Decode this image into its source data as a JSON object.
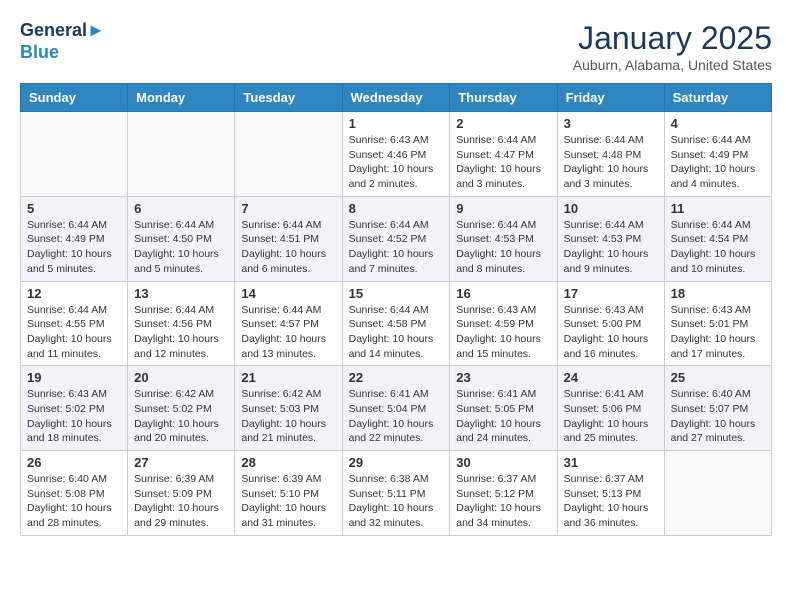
{
  "header": {
    "logo_line1": "General",
    "logo_line2": "Blue",
    "month_title": "January 2025",
    "location": "Auburn, Alabama, United States"
  },
  "days_of_week": [
    "Sunday",
    "Monday",
    "Tuesday",
    "Wednesday",
    "Thursday",
    "Friday",
    "Saturday"
  ],
  "weeks": [
    [
      {
        "day": "",
        "info": ""
      },
      {
        "day": "",
        "info": ""
      },
      {
        "day": "",
        "info": ""
      },
      {
        "day": "1",
        "info": "Sunrise: 6:43 AM\nSunset: 4:46 PM\nDaylight: 10 hours\nand 2 minutes."
      },
      {
        "day": "2",
        "info": "Sunrise: 6:44 AM\nSunset: 4:47 PM\nDaylight: 10 hours\nand 3 minutes."
      },
      {
        "day": "3",
        "info": "Sunrise: 6:44 AM\nSunset: 4:48 PM\nDaylight: 10 hours\nand 3 minutes."
      },
      {
        "day": "4",
        "info": "Sunrise: 6:44 AM\nSunset: 4:49 PM\nDaylight: 10 hours\nand 4 minutes."
      }
    ],
    [
      {
        "day": "5",
        "info": "Sunrise: 6:44 AM\nSunset: 4:49 PM\nDaylight: 10 hours\nand 5 minutes."
      },
      {
        "day": "6",
        "info": "Sunrise: 6:44 AM\nSunset: 4:50 PM\nDaylight: 10 hours\nand 5 minutes."
      },
      {
        "day": "7",
        "info": "Sunrise: 6:44 AM\nSunset: 4:51 PM\nDaylight: 10 hours\nand 6 minutes."
      },
      {
        "day": "8",
        "info": "Sunrise: 6:44 AM\nSunset: 4:52 PM\nDaylight: 10 hours\nand 7 minutes."
      },
      {
        "day": "9",
        "info": "Sunrise: 6:44 AM\nSunset: 4:53 PM\nDaylight: 10 hours\nand 8 minutes."
      },
      {
        "day": "10",
        "info": "Sunrise: 6:44 AM\nSunset: 4:53 PM\nDaylight: 10 hours\nand 9 minutes."
      },
      {
        "day": "11",
        "info": "Sunrise: 6:44 AM\nSunset: 4:54 PM\nDaylight: 10 hours\nand 10 minutes."
      }
    ],
    [
      {
        "day": "12",
        "info": "Sunrise: 6:44 AM\nSunset: 4:55 PM\nDaylight: 10 hours\nand 11 minutes."
      },
      {
        "day": "13",
        "info": "Sunrise: 6:44 AM\nSunset: 4:56 PM\nDaylight: 10 hours\nand 12 minutes."
      },
      {
        "day": "14",
        "info": "Sunrise: 6:44 AM\nSunset: 4:57 PM\nDaylight: 10 hours\nand 13 minutes."
      },
      {
        "day": "15",
        "info": "Sunrise: 6:44 AM\nSunset: 4:58 PM\nDaylight: 10 hours\nand 14 minutes."
      },
      {
        "day": "16",
        "info": "Sunrise: 6:43 AM\nSunset: 4:59 PM\nDaylight: 10 hours\nand 15 minutes."
      },
      {
        "day": "17",
        "info": "Sunrise: 6:43 AM\nSunset: 5:00 PM\nDaylight: 10 hours\nand 16 minutes."
      },
      {
        "day": "18",
        "info": "Sunrise: 6:43 AM\nSunset: 5:01 PM\nDaylight: 10 hours\nand 17 minutes."
      }
    ],
    [
      {
        "day": "19",
        "info": "Sunrise: 6:43 AM\nSunset: 5:02 PM\nDaylight: 10 hours\nand 18 minutes."
      },
      {
        "day": "20",
        "info": "Sunrise: 6:42 AM\nSunset: 5:02 PM\nDaylight: 10 hours\nand 20 minutes."
      },
      {
        "day": "21",
        "info": "Sunrise: 6:42 AM\nSunset: 5:03 PM\nDaylight: 10 hours\nand 21 minutes."
      },
      {
        "day": "22",
        "info": "Sunrise: 6:41 AM\nSunset: 5:04 PM\nDaylight: 10 hours\nand 22 minutes."
      },
      {
        "day": "23",
        "info": "Sunrise: 6:41 AM\nSunset: 5:05 PM\nDaylight: 10 hours\nand 24 minutes."
      },
      {
        "day": "24",
        "info": "Sunrise: 6:41 AM\nSunset: 5:06 PM\nDaylight: 10 hours\nand 25 minutes."
      },
      {
        "day": "25",
        "info": "Sunrise: 6:40 AM\nSunset: 5:07 PM\nDaylight: 10 hours\nand 27 minutes."
      }
    ],
    [
      {
        "day": "26",
        "info": "Sunrise: 6:40 AM\nSunset: 5:08 PM\nDaylight: 10 hours\nand 28 minutes."
      },
      {
        "day": "27",
        "info": "Sunrise: 6:39 AM\nSunset: 5:09 PM\nDaylight: 10 hours\nand 29 minutes."
      },
      {
        "day": "28",
        "info": "Sunrise: 6:39 AM\nSunset: 5:10 PM\nDaylight: 10 hours\nand 31 minutes."
      },
      {
        "day": "29",
        "info": "Sunrise: 6:38 AM\nSunset: 5:11 PM\nDaylight: 10 hours\nand 32 minutes."
      },
      {
        "day": "30",
        "info": "Sunrise: 6:37 AM\nSunset: 5:12 PM\nDaylight: 10 hours\nand 34 minutes."
      },
      {
        "day": "31",
        "info": "Sunrise: 6:37 AM\nSunset: 5:13 PM\nDaylight: 10 hours\nand 36 minutes."
      },
      {
        "day": "",
        "info": ""
      }
    ]
  ]
}
